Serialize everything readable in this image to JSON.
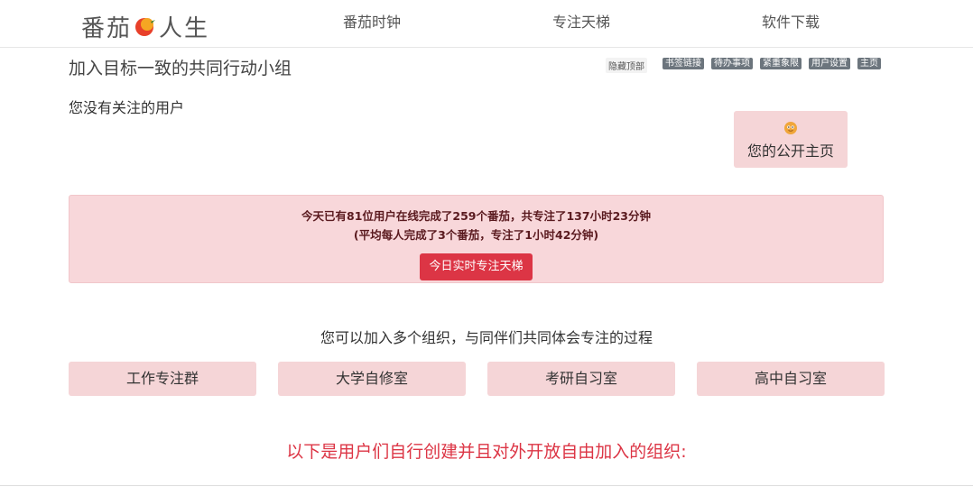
{
  "logo": {
    "left": "番茄",
    "right": "人生",
    "icon": "tomato-icon"
  },
  "nav": {
    "pomodoro": "番茄时钟",
    "ladder": "专注天梯",
    "download": "软件下载"
  },
  "page": {
    "title": "加入目标一致的共同行动小组"
  },
  "toolbar": {
    "hide_top": "隐藏顶部",
    "pills": [
      "书签链接",
      "待办事项",
      "紧重象限",
      "用户设置",
      "主页"
    ]
  },
  "follow": {
    "empty": "您没有关注的用户"
  },
  "public_card": {
    "label": "您的公开主页",
    "icon": "smiley-icon"
  },
  "stats": {
    "line1": "今天已有81位用户在线完成了259个番茄，共专注了137小时23分钟",
    "line2": "(平均每人完成了3个番茄，专注了1小时42分钟)",
    "button": "今日实时专注天梯"
  },
  "groups": {
    "intro": "您可以加入多个组织，与同伴们共同体会专注的过程",
    "items": [
      "工作专注群",
      "大学自修室",
      "考研自习室",
      "高中自习室"
    ]
  },
  "user_groups": {
    "heading": "以下是用户们自行创建并且对外开放自由加入的组织:"
  },
  "colors": {
    "accent": "#dc3545",
    "card_bg": "#f5d5d7",
    "alert_bg": "#f8d7da",
    "pill_bg": "#6c757d"
  }
}
